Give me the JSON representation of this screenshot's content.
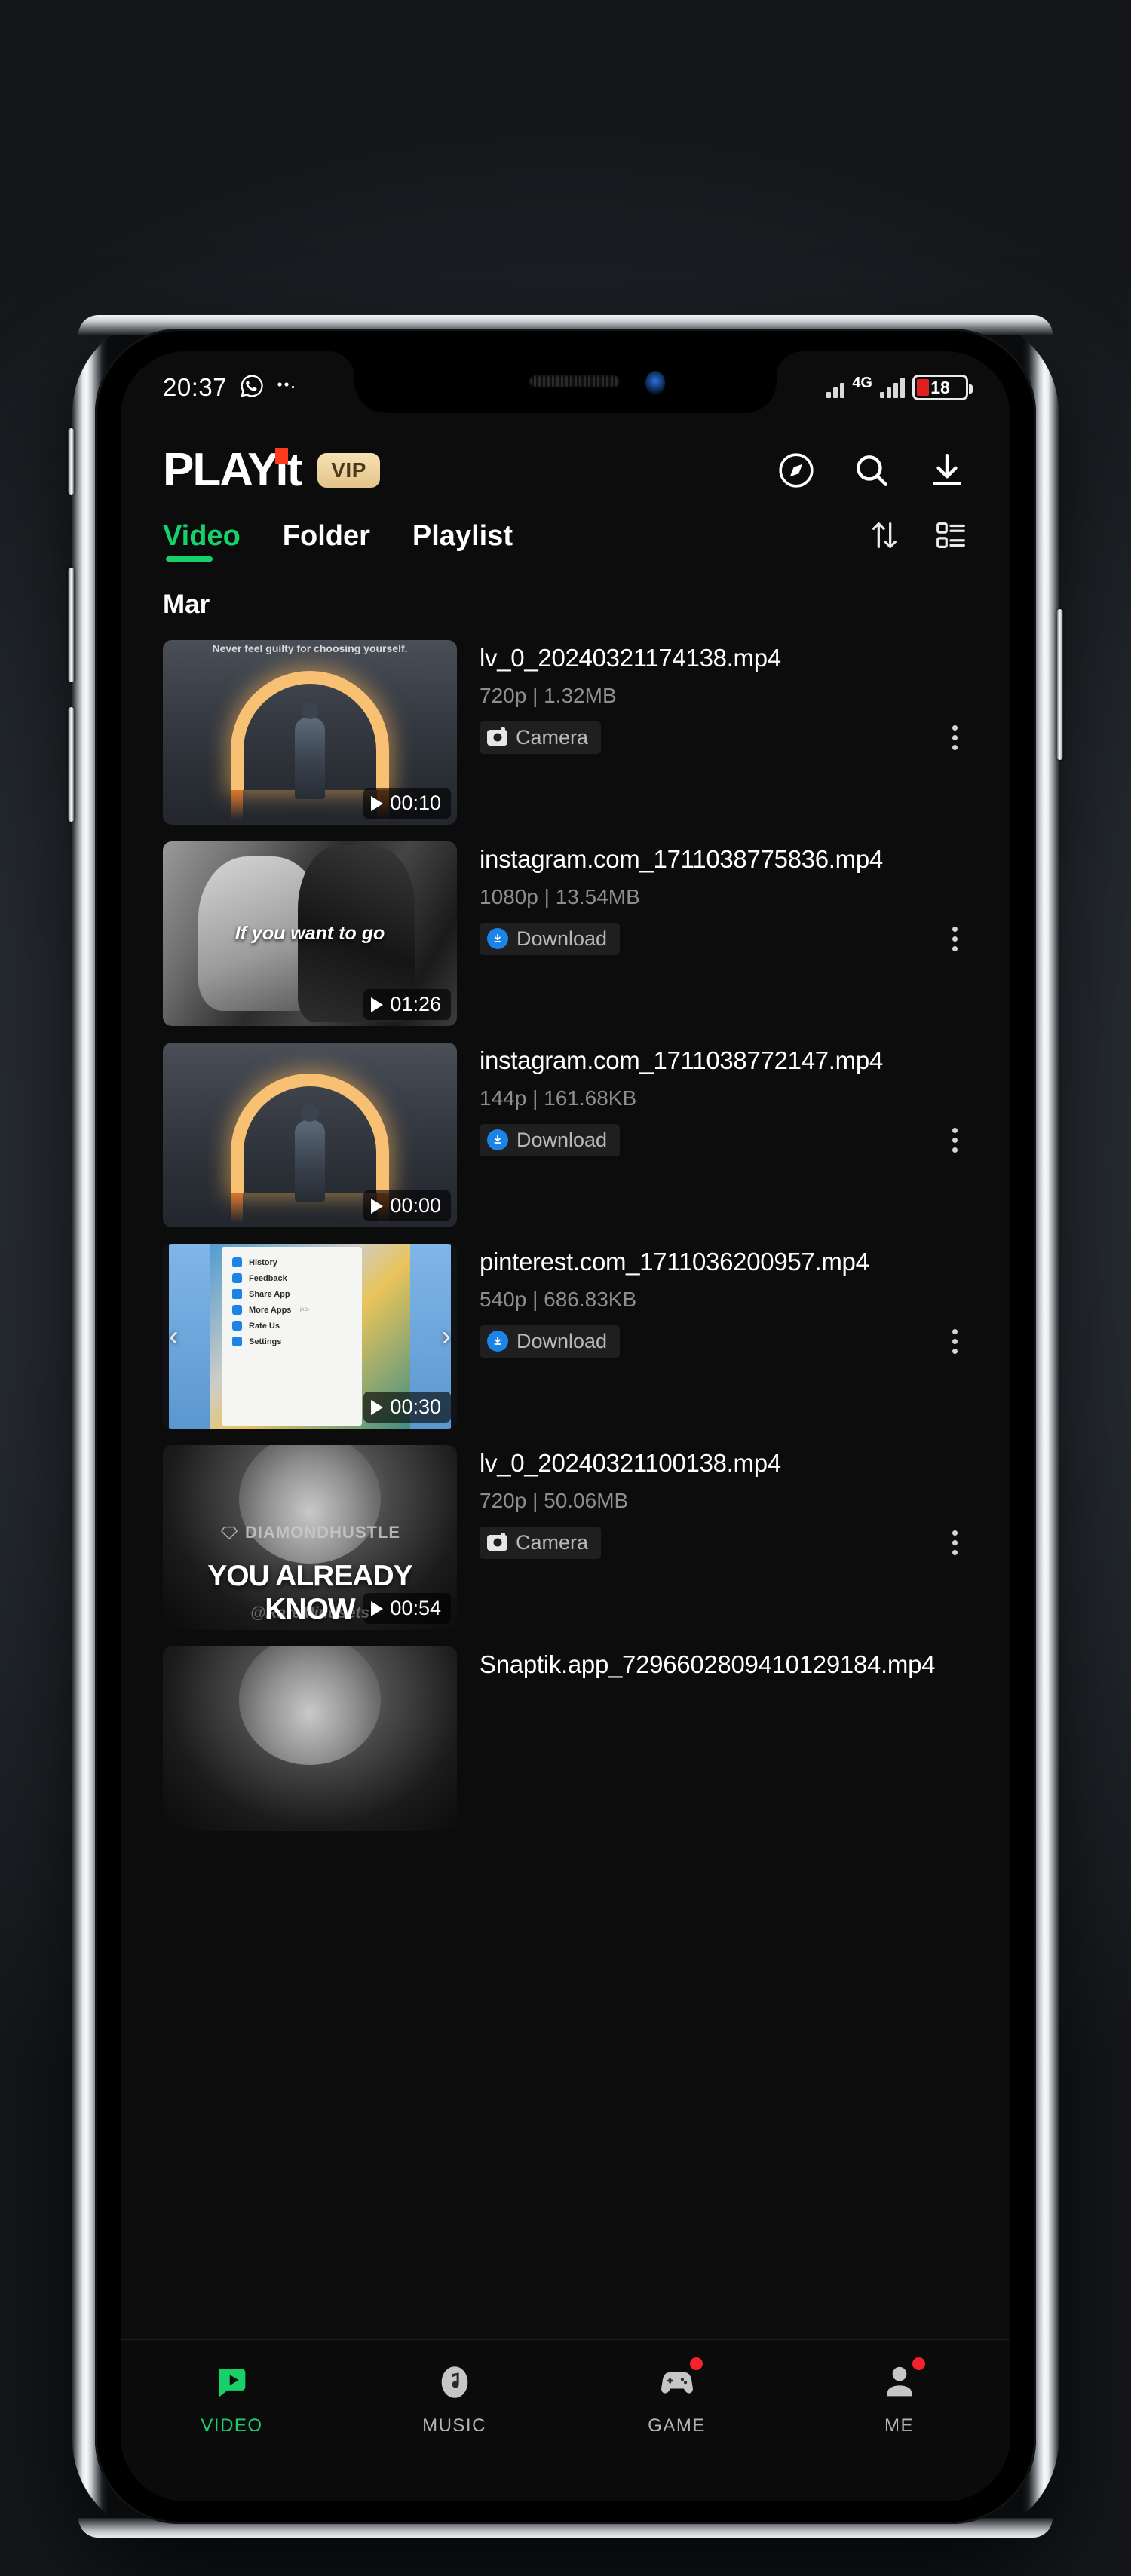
{
  "status_bar": {
    "time": "20:37",
    "whatsapp_icon": "whatsapp-icon",
    "more_notifications_icon": "ellipsis-icon",
    "network_type": "4G",
    "battery_percent": "18"
  },
  "header": {
    "logo_text": "PLAYit",
    "vip_badge": "VIP",
    "icons": [
      {
        "name": "compass-icon",
        "label": "Discover"
      },
      {
        "name": "search-icon",
        "label": "Search"
      },
      {
        "name": "download-icon",
        "label": "Downloads"
      }
    ]
  },
  "tabs": {
    "items": [
      {
        "label": "Video",
        "active": true
      },
      {
        "label": "Folder",
        "active": false
      },
      {
        "label": "Playlist",
        "active": false
      }
    ],
    "actions": [
      {
        "name": "sort-icon",
        "label": "Sort"
      },
      {
        "name": "layout-grid-icon",
        "label": "View mode"
      }
    ]
  },
  "section": {
    "header": "Mar"
  },
  "videos": [
    {
      "title": "lv_0_20240321174138.mp4",
      "quality": "720p",
      "size": "1.32MB",
      "meta": "720p | 1.32MB",
      "duration": "00:10",
      "tag": "Camera",
      "tag_icon": "camera-icon",
      "thumb_type": "arch",
      "thumb_caption": "Never feel guilty for choosing yourself."
    },
    {
      "title": "instagram.com_1711038775836.mp4",
      "quality": "1080p",
      "size": "13.54MB",
      "meta": "1080p | 13.54MB",
      "duration": "01:26",
      "tag": "Download",
      "tag_icon": "download-circle-icon",
      "thumb_type": "bw-interview",
      "thumb_caption": "If you want to go"
    },
    {
      "title": "instagram.com_1711038772147.mp4",
      "quality": "144p",
      "size": "161.68KB",
      "meta": "144p | 161.68KB",
      "duration": "00:00",
      "tag": "Download",
      "tag_icon": "download-circle-icon",
      "thumb_type": "arch",
      "thumb_caption": ""
    },
    {
      "title": "pinterest.com_1711036200957.mp4",
      "quality": "540p",
      "size": "686.83KB",
      "meta": "540p | 686.83KB",
      "duration": "00:30",
      "tag": "Download",
      "tag_icon": "download-circle-icon",
      "thumb_type": "app-menu",
      "thumb_caption": "",
      "thumb_menu_items": [
        "History",
        "Feedback",
        "Share App",
        "More Apps",
        "Rate Us",
        "Settings"
      ],
      "thumb_menu_ad_label": "(AD)"
    },
    {
      "title": "lv_0_20240321100138.mp4",
      "quality": "720p",
      "size": "50.06MB",
      "meta": "720p | 50.06MB",
      "duration": "00:54",
      "tag": "Camera",
      "tag_icon": "camera-icon",
      "thumb_type": "diamondhustle",
      "thumb_watermark": "DIAMONDHUSTLE",
      "thumb_caption": "YOU ALREADY KNOW",
      "thumb_handle": "@RareMindsets"
    },
    {
      "title": "Snaptik.app_7296602809410129184.mp4",
      "quality": "",
      "size": "",
      "meta": "",
      "duration": "",
      "tag": "",
      "tag_icon": "",
      "thumb_type": "diamondhustle",
      "thumb_watermark": "",
      "thumb_caption": "",
      "thumb_handle": ""
    }
  ],
  "bottom_nav": [
    {
      "label": "VIDEO",
      "icon": "video-play-icon",
      "active": true,
      "badge": false
    },
    {
      "label": "MUSIC",
      "icon": "music-note-icon",
      "active": false,
      "badge": false
    },
    {
      "label": "GAME",
      "icon": "gamepad-icon",
      "active": false,
      "badge": true
    },
    {
      "label": "ME",
      "icon": "person-icon",
      "active": false,
      "badge": true
    }
  ],
  "colors": {
    "accent_green": "#18d06a",
    "vip_gold": "#e4c489",
    "download_blue": "#1b84e8",
    "badge_red": "#f5222d",
    "battery_red": "#e02020"
  }
}
